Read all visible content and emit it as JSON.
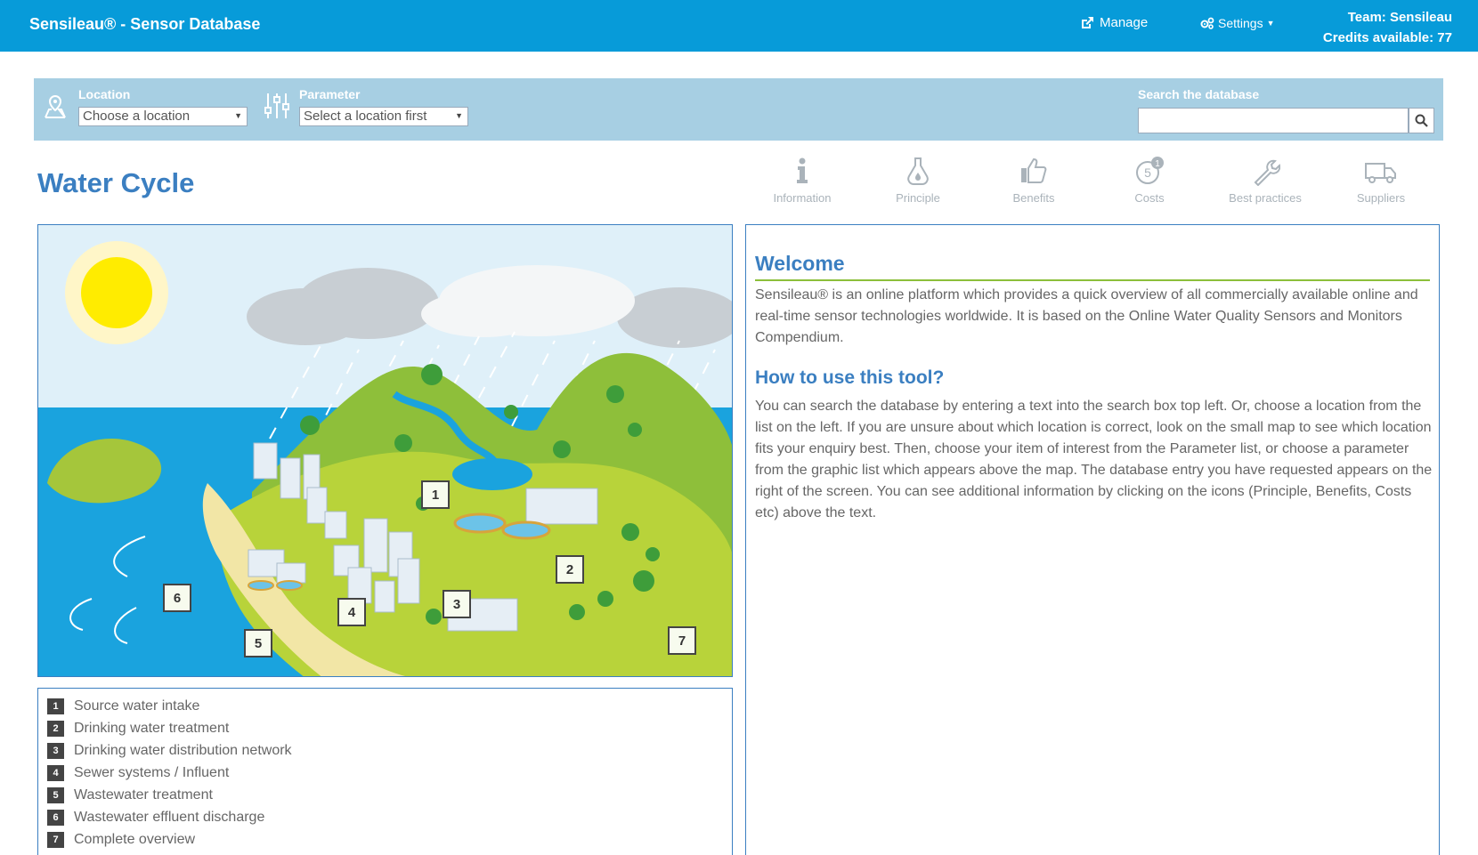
{
  "header": {
    "brand": "Sensileau® - Sensor Database",
    "manage_label": "Manage",
    "settings_label": "Settings",
    "team_label": "Team: Sensileau",
    "credits_label": "Credits available: 77"
  },
  "filters": {
    "location_label": "Location",
    "location_value": "Choose a location",
    "parameter_label": "Parameter",
    "parameter_value": "Select a location first",
    "search_label": "Search the database",
    "search_value": ""
  },
  "page_title": "Water Cycle",
  "toolbar": {
    "items": [
      {
        "label": "Information",
        "icon": "info-icon"
      },
      {
        "label": "Principle",
        "icon": "flask-icon"
      },
      {
        "label": "Benefits",
        "icon": "thumbs-up-icon"
      },
      {
        "label": "Costs",
        "icon": "coin-icon",
        "badge": "1",
        "coin": "5"
      },
      {
        "label": "Best practices",
        "icon": "wrench-icon"
      },
      {
        "label": "Suppliers",
        "icon": "truck-icon"
      }
    ]
  },
  "map": {
    "markers": [
      "1",
      "2",
      "3",
      "4",
      "5",
      "6",
      "7"
    ]
  },
  "legend": {
    "items": [
      {
        "num": "1",
        "label": "Source water intake"
      },
      {
        "num": "2",
        "label": "Drinking water treatment"
      },
      {
        "num": "3",
        "label": "Drinking water distribution network"
      },
      {
        "num": "4",
        "label": "Sewer systems / Influent"
      },
      {
        "num": "5",
        "label": "Wastewater treatment"
      },
      {
        "num": "6",
        "label": "Wastewater effluent discharge"
      },
      {
        "num": "7",
        "label": "Complete overview"
      }
    ]
  },
  "info": {
    "welcome_title": "Welcome",
    "welcome_text": "Sensileau® is an online platform which provides a quick overview of all commercially available online and real-time sensor technologies worldwide. It is based on the Online Water Quality Sensors and Monitors Compendium.",
    "howto_title": "How to use this tool?",
    "howto_text": "You can search the database by entering a text into the search box top left. Or, choose a location from the list on the left. If you are unsure about which location is correct, look on the small map to see which location fits your enquiry best. Then, choose your item of interest from the Parameter list, or choose a parameter from the graphic list which appears above the map. The database entry you have requested appears on the right of the screen. You can see additional information by clicking on the icons (Principle, Benefits, Costs etc) above the text."
  },
  "colors": {
    "topbar": "#079bd9",
    "filterbar": "#a7cfe3",
    "title_blue": "#3b7fc1",
    "welcome_underline": "#8cbf3a",
    "icon_grey": "#aab3ba"
  }
}
